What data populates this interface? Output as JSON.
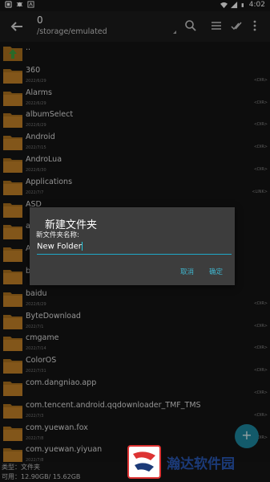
{
  "status_bar": {
    "left_icons": [
      "notification-icon",
      "bug-icon",
      "app-icon"
    ],
    "time": "4:02"
  },
  "app_bar": {
    "count": "0",
    "path": "/storage/emulated"
  },
  "files": [
    {
      "name": "..",
      "date": "",
      "tag": ""
    },
    {
      "name": "360",
      "date": "2022/6/29",
      "tag": "<DIR>"
    },
    {
      "name": "Alarms",
      "date": "2022/6/29",
      "tag": "<DIR>"
    },
    {
      "name": "albumSelect",
      "date": "2022/6/29",
      "tag": "<DIR>"
    },
    {
      "name": "Android",
      "date": "2022/7/15",
      "tag": "<DIR>"
    },
    {
      "name": "AndroLua",
      "date": "2022/6/30",
      "tag": "<DIR>"
    },
    {
      "name": "Applications",
      "date": "2022/7/7",
      "tag": "<LINK>"
    },
    {
      "name": "ASD",
      "date": "",
      "tag": ""
    },
    {
      "name": "at",
      "date": "",
      "tag": ""
    },
    {
      "name": "Au",
      "date": "",
      "tag": ""
    },
    {
      "name": "ba",
      "date": "",
      "tag": ""
    },
    {
      "name": "baidu",
      "date": "2022/6/29",
      "tag": "<DIR>"
    },
    {
      "name": "ByteDownload",
      "date": "2022/7/1",
      "tag": "<DIR>"
    },
    {
      "name": "cmgame",
      "date": "2022/7/14",
      "tag": "<DIR>"
    },
    {
      "name": "ColorOS",
      "date": "2022/7/31",
      "tag": "<DIR>"
    },
    {
      "name": "com.dangniao.app",
      "date": "",
      "tag": "<DIR>"
    },
    {
      "name": "com.tencent.android.qqdownloader_TMF_TMS",
      "date": "2022/7/3",
      "tag": "<DIR>"
    },
    {
      "name": "com.yuewan.fox",
      "date": "2022/7/8",
      "tag": "<DIR>"
    },
    {
      "name": "com.yuewan.yiyuan",
      "date": "2022/7/8",
      "tag": ""
    }
  ],
  "dialog": {
    "title": "新建文件夹",
    "label": "新文件夹名称:",
    "value": "New Folder",
    "cancel": "取消",
    "ok": "确定"
  },
  "fab": {
    "label": "+"
  },
  "bottom": {
    "type_line": "类型：文件夹",
    "space_line": "可用：12.90GB/ 15.62GB"
  },
  "watermark": {
    "text": "瀚达软件园"
  },
  "colors": {
    "accent": "#1fa8c8",
    "folder": "#b0741f",
    "dialog_bg": "#3d3d3d"
  }
}
